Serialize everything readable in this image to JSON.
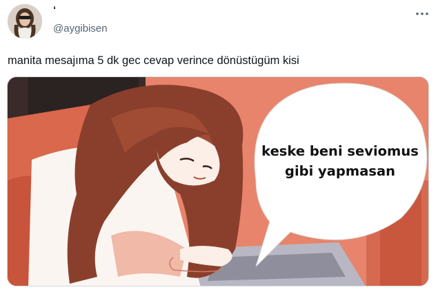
{
  "author": {
    "display_name": "‘",
    "handle": "@aygibisen",
    "avatar_icon": "user-avatar"
  },
  "more_icon": "more-dots-icon",
  "tweet": {
    "text": "manita mesajıma 5 dk gec cevap verince dönüstügüm kisi"
  },
  "media": {
    "bubble_line_1": "keske beni seviomus",
    "bubble_line_2": "gibi yapmasan"
  },
  "colors": {
    "text_primary": "#0f1419",
    "text_secondary": "#536471",
    "border": "#cfd9de",
    "background_orange": "#e9836a",
    "hair_brown": "#8a3f2c"
  }
}
